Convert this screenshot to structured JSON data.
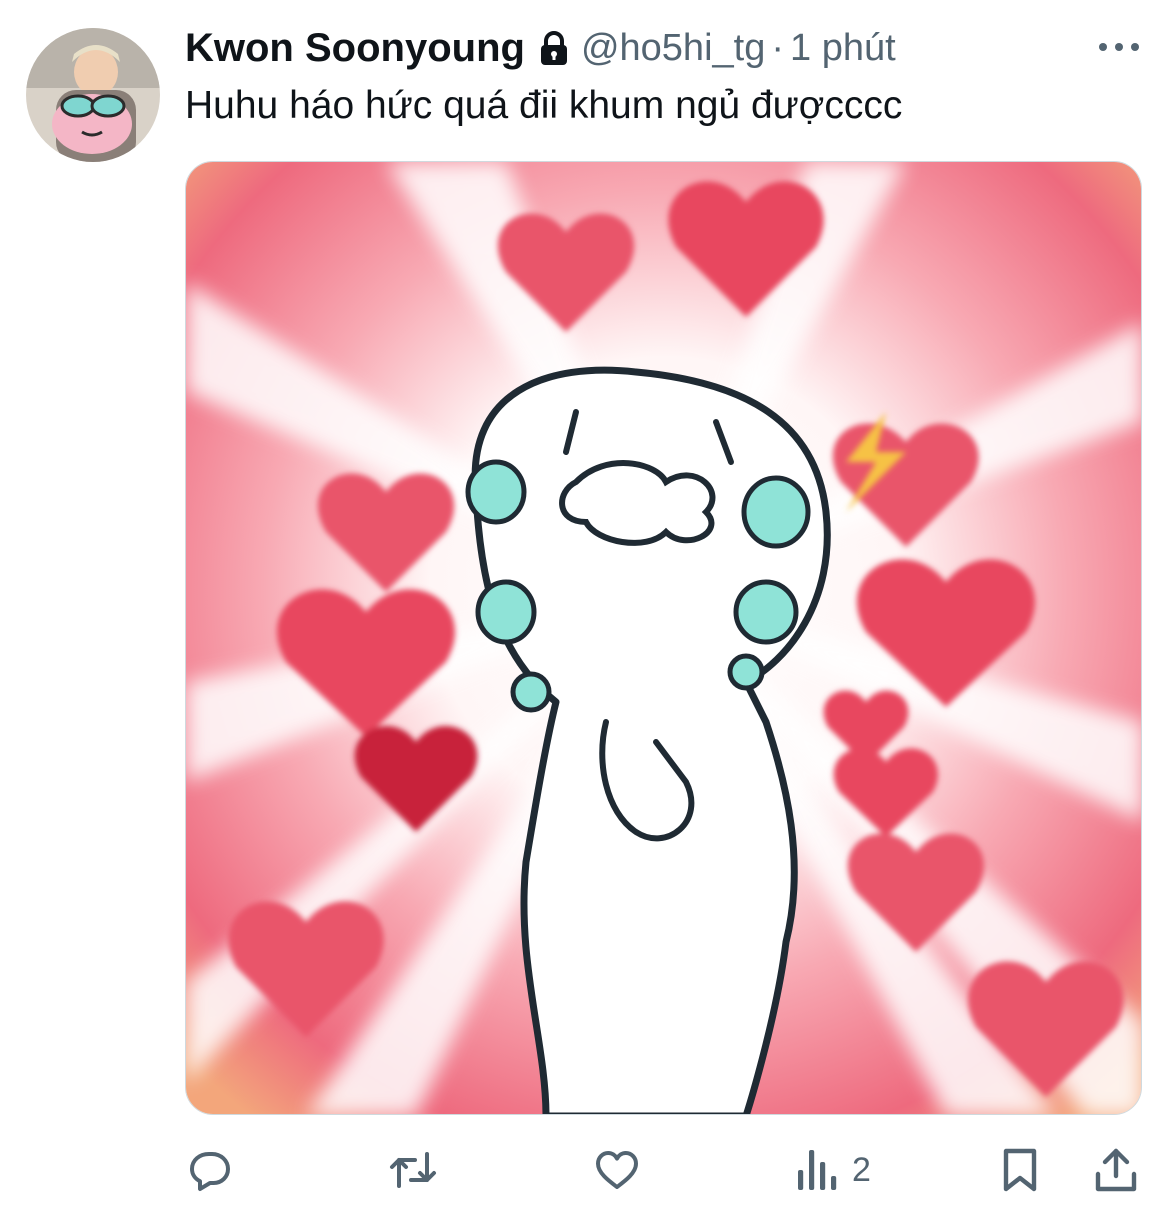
{
  "tweet": {
    "display_name": "Kwon Soonyoung",
    "handle": "@ho5hi_tg",
    "separator": "·",
    "time": "1 phút",
    "text": "Huhu háo hức quá đii khum ngủ đượcccc",
    "protected": true
  },
  "metrics": {
    "views": "2"
  },
  "icons": {
    "protected": "lock-icon",
    "more": "more-dots-icon",
    "reply": "reply-icon",
    "retweet": "retweet-icon",
    "like": "heart-icon",
    "views": "analytics-icon",
    "bookmark": "bookmark-icon",
    "share": "share-icon"
  },
  "colors": {
    "text_primary": "#0f1419",
    "text_secondary": "#536471",
    "divider": "#cfd9de"
  }
}
